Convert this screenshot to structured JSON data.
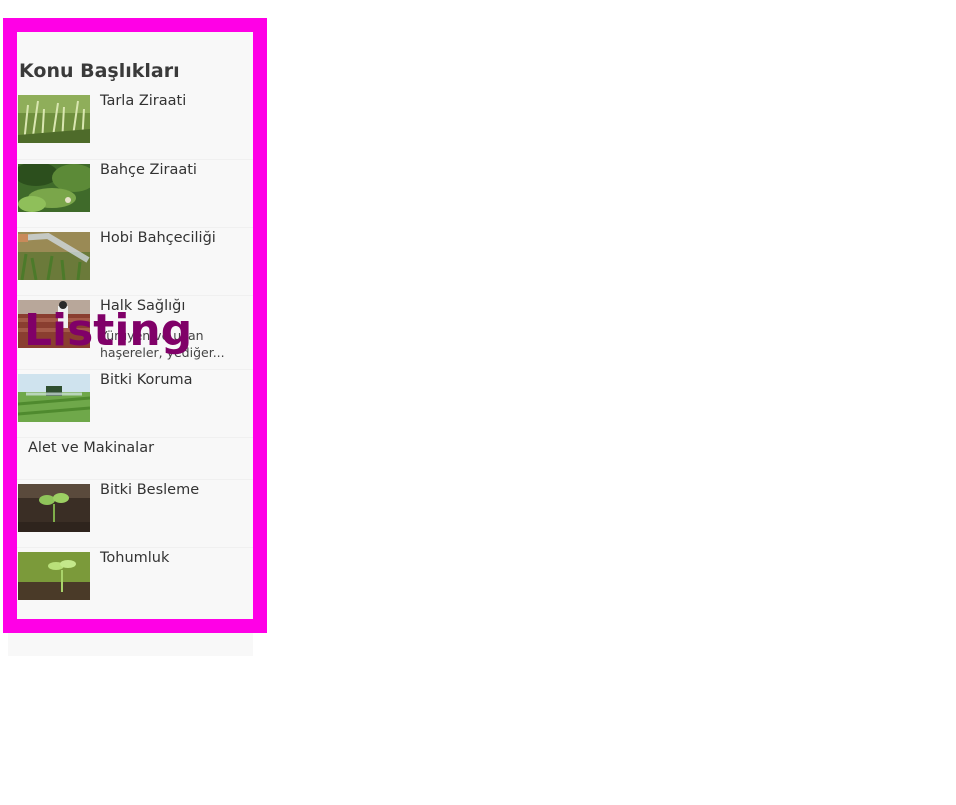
{
  "sidebar": {
    "title": "Konu Başlıkları",
    "items": [
      {
        "label": "Tarla Ziraati"
      },
      {
        "label": "Bahçe Ziraati"
      },
      {
        "label": "Hobi Bahçeciliği"
      },
      {
        "label": "Halk Sağlığı",
        "excerpt": "Yürüyen ve uçan haşereler, yediğer..."
      },
      {
        "label": "Bitki Koruma"
      },
      {
        "label": "Alet ve Makinalar"
      },
      {
        "label": "Bitki Besleme"
      },
      {
        "label": "Tohumluk"
      }
    ]
  },
  "overlay": {
    "label": "Listing"
  },
  "colors": {
    "frame_border": "#ff00e6",
    "panel_bg": "#f8f8f8",
    "overlay_text": "#800068"
  }
}
